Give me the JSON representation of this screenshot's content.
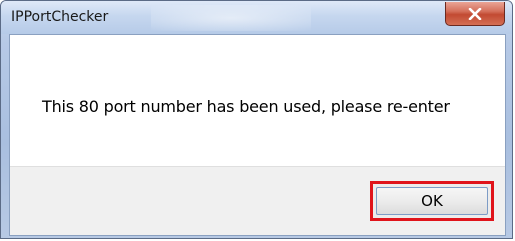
{
  "window": {
    "title": "IPPortChecker"
  },
  "dialog": {
    "message": "This 80 port number has been used, please re-enter",
    "ok_label": "OK"
  },
  "icons": {
    "close": "close-icon"
  },
  "colors": {
    "highlight_border": "#e0141b",
    "close_button": "#c24a32"
  }
}
